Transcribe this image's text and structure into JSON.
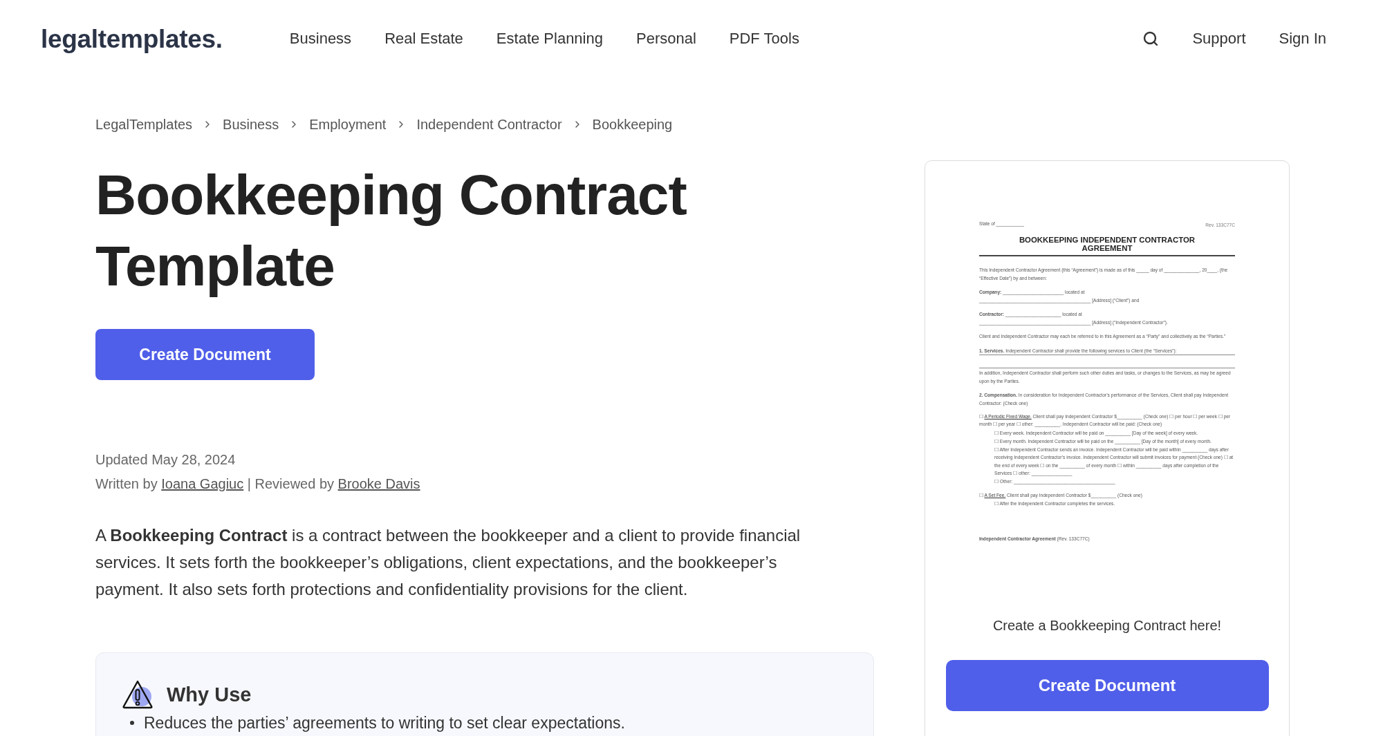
{
  "header": {
    "logo": "legaltemplates.",
    "nav": [
      "Business",
      "Real Estate",
      "Estate Planning",
      "Personal",
      "PDF Tools"
    ],
    "right_links": [
      "Support",
      "Sign In"
    ]
  },
  "breadcrumb": [
    "LegalTemplates",
    "Business",
    "Employment",
    "Independent Contractor",
    "Bookkeeping"
  ],
  "title": "Bookkeeping Contract Template",
  "cta_button": "Create Document",
  "updated": "Updated May 28, 2024",
  "byline": [
    {
      "kind": "text",
      "text": "Written by"
    },
    {
      "kind": "link",
      "text": "Ioana Gagiuc"
    },
    {
      "kind": "text",
      "text": "| Reviewed by"
    },
    {
      "kind": "link",
      "text": "Brooke Davis"
    }
  ],
  "description": "A **Bookkeeping Contract** is a contract between the bookkeeper and a client to provide financial services. It sets forth the bookkeeper’s obligations, client expectations, and the bookkeeper’s payment. It also sets forth protections and confidentiality provisions for the client.",
  "why_use": {
    "title": "Why Use",
    "items": [
      "Reduces the parties’ agreements to writing to set clear expectations."
    ]
  },
  "preview_card": {
    "document": {
      "state_line": "State of ___________",
      "revision": "Rev. 133C77C",
      "title": "BOOKKEEPING INDEPENDENT CONTRACTOR AGREEMENT",
      "blocks": [
        {
          "kind": "para",
          "text": "This Independent Contractor Agreement (this “Agreement”) is made as of this _____ day of ______________, 20____, (the “Effective Date”) by and between:"
        },
        {
          "kind": "lines",
          "lines": [
            "**Company:** ________________________ located at",
            "____________________________________________ [Address] (“Client”) and"
          ]
        },
        {
          "kind": "lines",
          "lines": [
            "**Contractor:** ______________________ located at",
            "____________________________________________ [Address] (“Independent Contractor”)."
          ]
        },
        {
          "kind": "para",
          "text": "Client and Independent Contractor may each be referred to in this Agreement as a “Party” and collectively as the “Parties.”"
        },
        {
          "kind": "para",
          "text": "**1. Services.** Independent Contractor shall provide the following services to Client (the “Services”):"
        },
        {
          "kind": "fill_line"
        },
        {
          "kind": "fill_line"
        },
        {
          "kind": "para",
          "text": "In addition, Independent Contractor shall perform such other duties and tasks, or changes to the Services, as may be agreed upon by the Parties."
        },
        {
          "kind": "para",
          "text": "**2. Compensation.** In consideration for Independent Contractor’s performance of the Services, Client shall pay Independent Contractor: (Check one)"
        },
        {
          "kind": "option",
          "box": "☐",
          "label": "A Periodic Fixed Wage.",
          "text": "Client shall pay Independent Contractor $__________ (Check one) ☐ per hour ☐ per week ☐ per month ☐ per year ☐ other: __________. Independent Contractor will be paid: (Check one)",
          "children": [
            {
              "kind": "option",
              "box": "☐",
              "text": "Every week. Independent Contractor will be paid on __________ [Day of the week] of every week."
            },
            {
              "kind": "option",
              "box": "☐",
              "text": "Every month. Independent Contractor will be paid on the __________ [Day of the month] of every month."
            },
            {
              "kind": "option",
              "box": "☐",
              "text": "After Independent Contractor sends an invoice. Independent Contractor will be paid within __________ days after receiving Independent Contractor’s invoice. Independent Contractor will submit invoices for payment (Check one) ☐ at the end of every week ☐ on the __________ of every month ☐ within __________ days after completion of the Services ☐ other: ________________"
            },
            {
              "kind": "option",
              "box": "☐",
              "text": "Other: ________________________________________"
            }
          ]
        },
        {
          "kind": "option",
          "box": "☐",
          "label": "A Set Fee.",
          "text": "Client shall pay Independent Contractor $__________ (Check one)",
          "children": [
            {
              "kind": "option",
              "box": "☐",
              "text": "After the Independent Contractor completes the services."
            }
          ]
        },
        {
          "kind": "footer",
          "text": "**Independent Contractor Agreement** (Rev. 133C77C)"
        }
      ]
    },
    "caption": "Create a Bookkeeping Contract here!",
    "button": "Create Document"
  }
}
